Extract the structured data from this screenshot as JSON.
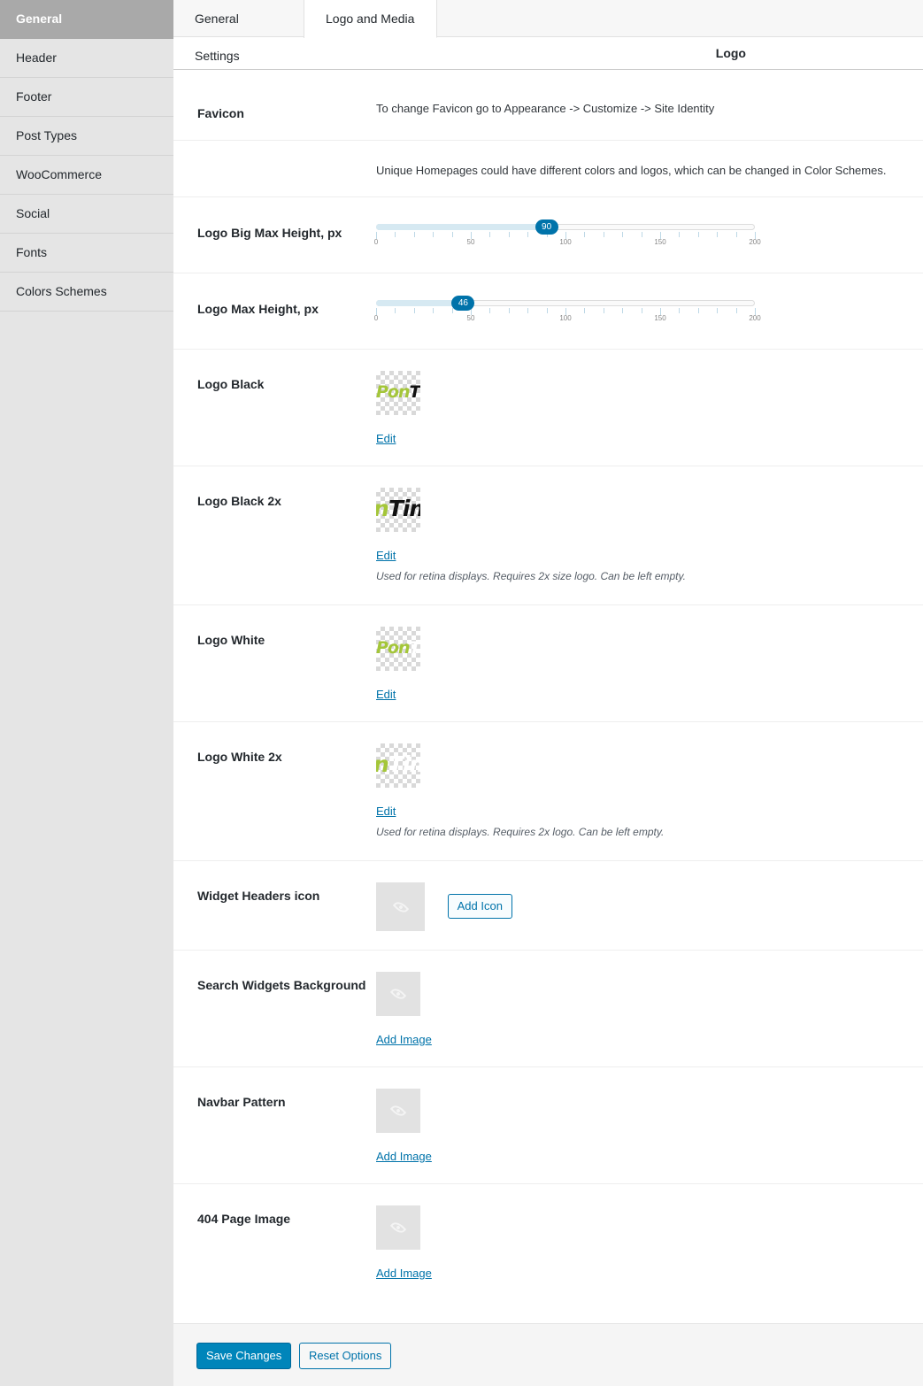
{
  "sidebar": {
    "items": [
      {
        "label": "General"
      },
      {
        "label": "Header"
      },
      {
        "label": "Footer"
      },
      {
        "label": "Post Types"
      },
      {
        "label": "WooCommerce"
      },
      {
        "label": "Social"
      },
      {
        "label": "Fonts"
      },
      {
        "label": "Colors Schemes"
      }
    ],
    "active_index": 0
  },
  "tabs": [
    {
      "label": "General Settings"
    },
    {
      "label": "Logo and Media"
    }
  ],
  "active_tab": 1,
  "section": {
    "title": "Logo"
  },
  "favicon": {
    "label": "Favicon",
    "text": "To change Favicon go to Appearance -> Customize -> Site Identity"
  },
  "homepages_note": {
    "text": "Unique Homepages could have different colors and logos, which can be changed in Color Schemes."
  },
  "logo_big_max_height": {
    "label": "Logo Big Max Height, px",
    "value": 90,
    "value_label": "90",
    "min": 0,
    "max": 200,
    "tick_labels": [
      "0",
      "50",
      "100",
      "150",
      "200"
    ]
  },
  "logo_max_height": {
    "label": "Logo Max Height, px",
    "value": 46,
    "value_label": "46",
    "min": 0,
    "max": 200,
    "tick_labels": [
      "0",
      "50",
      "100",
      "150",
      "200"
    ]
  },
  "logo_black": {
    "label": "Logo Black",
    "edit_label": "Edit"
  },
  "logo_black_2x": {
    "label": "Logo Black 2x",
    "edit_label": "Edit",
    "description": "Used for retina displays. Requires 2x size logo. Can be left empty."
  },
  "logo_white": {
    "label": "Logo White",
    "edit_label": "Edit"
  },
  "logo_white_2x": {
    "label": "Logo White 2x",
    "edit_label": "Edit",
    "description": "Used for retina displays. Requires 2x logo. Can be left empty."
  },
  "widget_headers_icon": {
    "label": "Widget Headers icon",
    "button_label": "Add Icon"
  },
  "search_widgets_background": {
    "label": "Search Widgets Background",
    "link_label": "Add Image"
  },
  "navbar_pattern": {
    "label": "Navbar Pattern",
    "link_label": "Add Image"
  },
  "page_404_image": {
    "label": "404 Page Image",
    "link_label": "Add Image"
  },
  "footer": {
    "save_label": "Save Changes",
    "reset_label": "Reset Options"
  },
  "colors": {
    "accent": "#0073aa",
    "primary_button": "#0085ba",
    "logo_green": "#a4c639"
  },
  "icons": {
    "placeholder": "eye-icon"
  }
}
